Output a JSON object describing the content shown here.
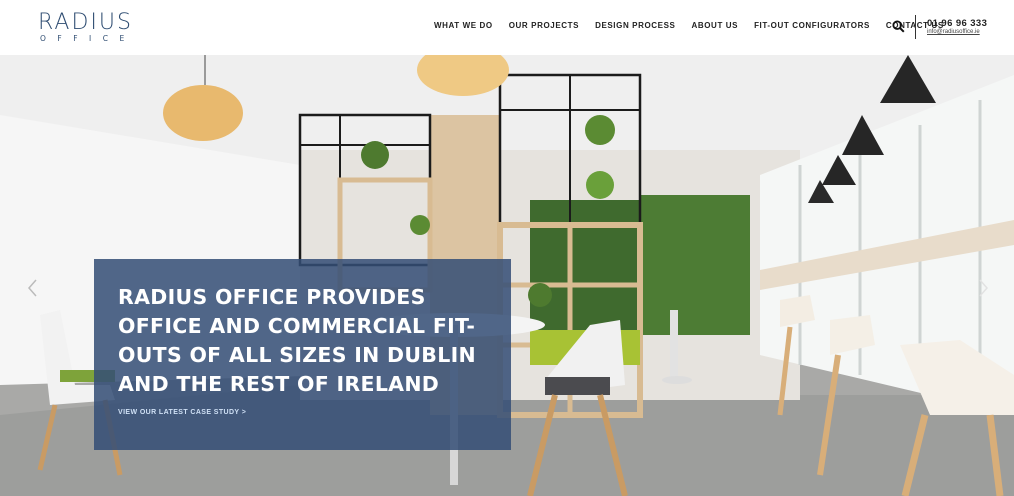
{
  "brand": {
    "name": "RADIUS",
    "sub": "OFFICE"
  },
  "nav": {
    "items": [
      "WHAT WE DO",
      "OUR PROJECTS",
      "DESIGN PROCESS",
      "ABOUT US",
      "FIT-OUT CONFIGURATORS",
      "CONTACT US"
    ]
  },
  "contact": {
    "phone": "01 96 96 333",
    "email": "info@radiusoffice.ie"
  },
  "hero": {
    "title": "RADIUS OFFICE PROVIDES OFFICE AND COMMERCIAL FIT-OUTS OF ALL SIZES IN DUBLIN AND THE REST OF IRELAND",
    "link": "VIEW OUR LATEST CASE STUDY >"
  },
  "icons": {
    "search": "search-icon",
    "prev": "chevron-left-icon",
    "next": "chevron-right-icon"
  }
}
